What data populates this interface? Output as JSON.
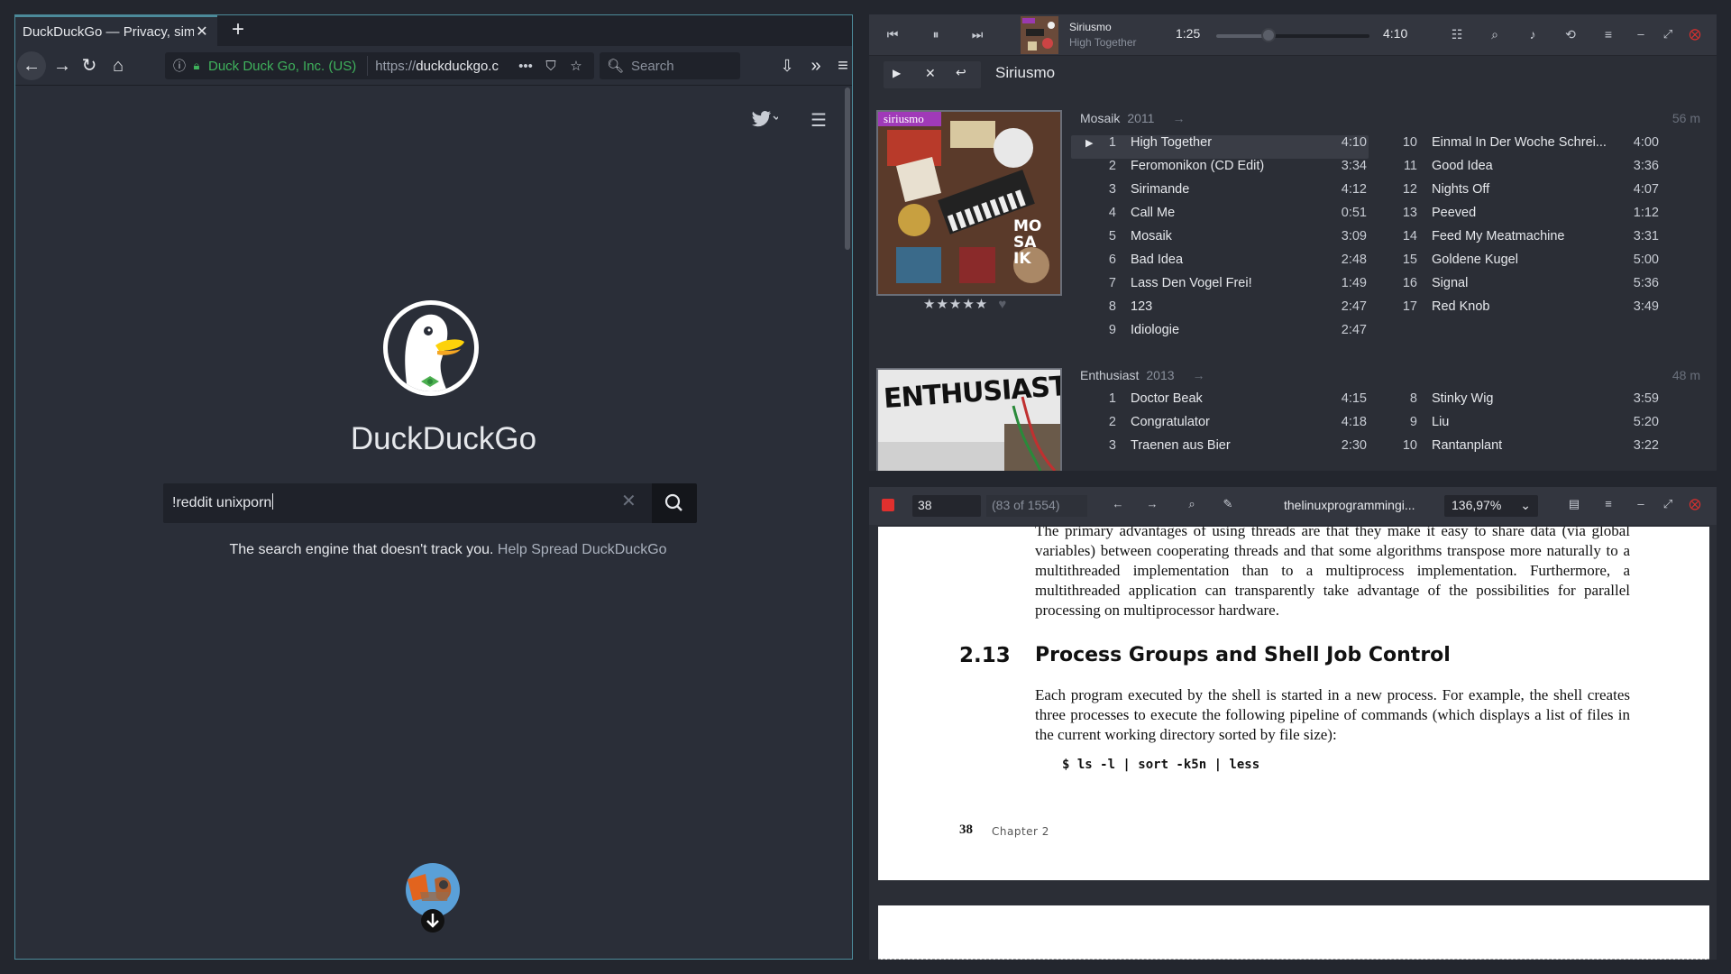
{
  "firefox": {
    "tab_title": "DuckDuckGo — Privacy, sim",
    "url_org": "Duck Duck Go, Inc. (US)",
    "url_prefix": "https://",
    "url_host": "duckduckgo.c",
    "search_placeholder": "Search"
  },
  "ddg": {
    "title": "DuckDuckGo",
    "query": "!reddit unixporn",
    "tagline": "The search engine that doesn't track you.",
    "tagline_link": "Help Spread DuckDuckGo"
  },
  "player": {
    "now_artist": "Siriusmo",
    "now_song": "High Together",
    "position": "1:25",
    "length": "4:10",
    "progress_fraction": 0.34,
    "artist_header": "Siriusmo",
    "albums": [
      {
        "title": "Mosaik",
        "year": "2011",
        "duration": "56 m",
        "cover_label": "siriusmo",
        "cover_text": "MO SA IK",
        "rating": "★★★★★",
        "tracks_left": [
          {
            "n": "1",
            "title": "High Together",
            "len": "4:10",
            "current": true
          },
          {
            "n": "2",
            "title": "Feromonikon (CD Edit)",
            "len": "3:34"
          },
          {
            "n": "3",
            "title": "Sirimande",
            "len": "4:12"
          },
          {
            "n": "4",
            "title": "Call Me",
            "len": "0:51"
          },
          {
            "n": "5",
            "title": "Mosaik",
            "len": "3:09"
          },
          {
            "n": "6",
            "title": "Bad Idea",
            "len": "2:48"
          },
          {
            "n": "7",
            "title": "Lass Den Vogel Frei!",
            "len": "1:49"
          },
          {
            "n": "8",
            "title": "123",
            "len": "2:47"
          },
          {
            "n": "9",
            "title": "Idiologie",
            "len": "2:47"
          }
        ],
        "tracks_right": [
          {
            "n": "10",
            "title": "Einmal In Der Woche Schrei...",
            "len": "4:00"
          },
          {
            "n": "11",
            "title": "Good Idea",
            "len": "3:36"
          },
          {
            "n": "12",
            "title": "Nights Off",
            "len": "4:07"
          },
          {
            "n": "13",
            "title": "Peeved",
            "len": "1:12"
          },
          {
            "n": "14",
            "title": "Feed My Meatmachine",
            "len": "3:31"
          },
          {
            "n": "15",
            "title": "Goldene Kugel",
            "len": "5:00"
          },
          {
            "n": "16",
            "title": "Signal",
            "len": "5:36"
          },
          {
            "n": "17",
            "title": "Red Knob",
            "len": "3:49"
          }
        ]
      },
      {
        "title": "Enthusiast",
        "year": "2013",
        "duration": "48 m",
        "cover_text": "ENTHUSIAST",
        "tracks_left": [
          {
            "n": "1",
            "title": "Doctor Beak",
            "len": "4:15"
          },
          {
            "n": "2",
            "title": "Congratulator",
            "len": "4:18"
          },
          {
            "n": "3",
            "title": "Traenen aus Bier",
            "len": "2:30"
          }
        ],
        "tracks_right": [
          {
            "n": "8",
            "title": "Stinky Wig",
            "len": "3:59"
          },
          {
            "n": "9",
            "title": "Liu",
            "len": "5:20"
          },
          {
            "n": "10",
            "title": "Rantanplant",
            "len": "3:22"
          }
        ]
      }
    ]
  },
  "pdf": {
    "page": "38",
    "count": "(83 of 1554)",
    "filename": "thelinuxprogrammingi...",
    "zoom": "136,97%",
    "para1": "The primary advantages of using threads are that they make it easy to share data (via global variables) between cooperating threads and that some algorithms transpose more naturally to a multithreaded implementation than to a multiprocess implementation. Furthermore, a multithreaded application can transparently take advantage of the possibilities for parallel processing on multiprocessor hardware.",
    "section_number": "2.13",
    "section_title": "Process Groups and Shell Job Control",
    "para2": "Each program executed by the shell is started in a new process. For example, the shell creates three processes to execute the following pipeline of commands (which displays a list of files in the current working directory sorted by file size):",
    "code": "$ ls -l | sort -k5n | less",
    "page_number": "38",
    "chapter": "Chapter 2"
  },
  "colors": {
    "accent": "#4c8a9a",
    "secure": "#3fb25c",
    "close": "#e0302e"
  }
}
